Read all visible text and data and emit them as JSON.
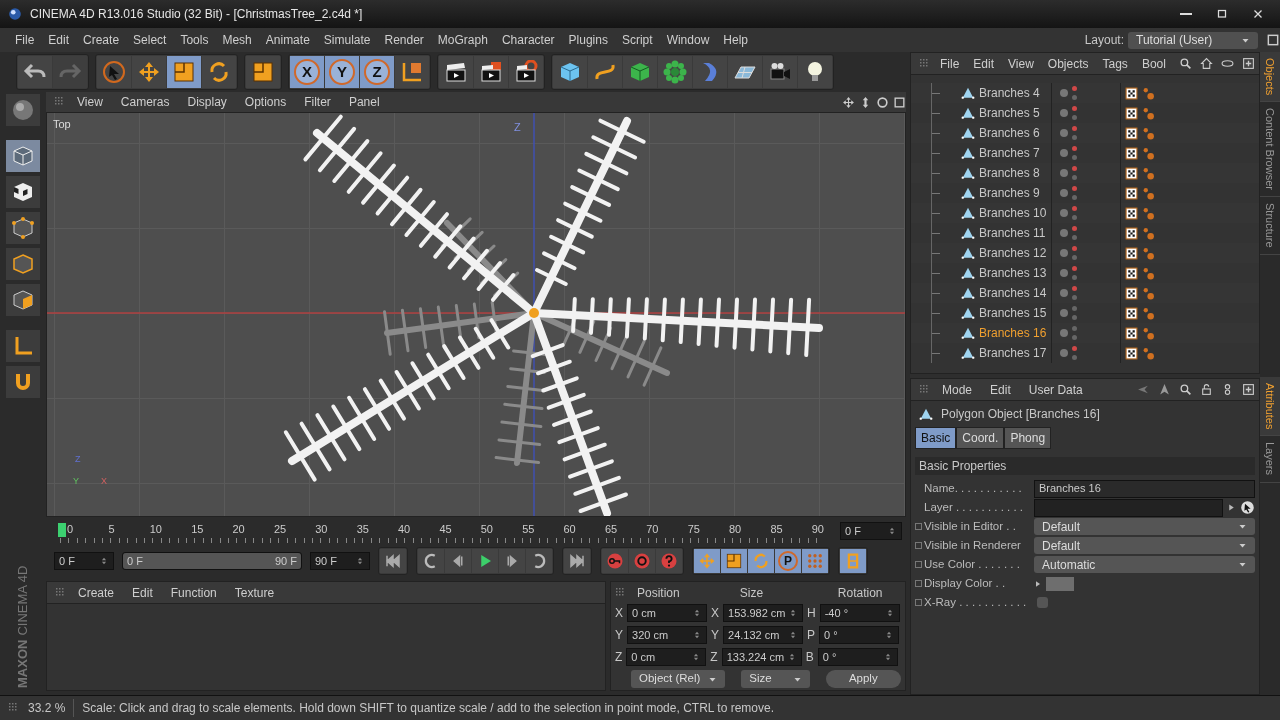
{
  "window": {
    "title": "CINEMA 4D R13.016 Studio (32 Bit) - [ChristmasTree_2.c4d *]"
  },
  "menu": [
    "File",
    "Edit",
    "Create",
    "Select",
    "Tools",
    "Mesh",
    "Animate",
    "Simulate",
    "Render",
    "MoGraph",
    "Character",
    "Plugins",
    "Script",
    "Window",
    "Help"
  ],
  "layout": {
    "label": "Layout:",
    "value": "Tutorial (User)"
  },
  "toolbar": [
    {
      "items": [
        {
          "kind": "undo",
          "disabled": false
        },
        {
          "kind": "redo",
          "disabled": true
        }
      ]
    },
    {
      "items": [
        {
          "kind": "select",
          "selected": false
        },
        {
          "kind": "move",
          "selected": false
        },
        {
          "kind": "scale",
          "selected": true
        },
        {
          "kind": "rotate",
          "selected": false
        }
      ]
    },
    {
      "items": [
        {
          "kind": "scale-model",
          "selected": false
        }
      ]
    },
    {
      "items": [
        {
          "kind": "axis",
          "label": "X",
          "selected": true
        },
        {
          "kind": "axis",
          "label": "Y",
          "selected": true
        },
        {
          "kind": "axis",
          "label": "Z",
          "selected": true
        },
        {
          "kind": "coord",
          "selected": false
        }
      ]
    },
    {
      "items": [
        {
          "kind": "render-view"
        },
        {
          "kind": "render-picture"
        },
        {
          "kind": "render-settings"
        }
      ]
    },
    {
      "items": [
        {
          "kind": "cube"
        },
        {
          "kind": "spline"
        },
        {
          "kind": "nurbs"
        },
        {
          "kind": "array"
        },
        {
          "kind": "deformer"
        },
        {
          "kind": "floor"
        },
        {
          "kind": "camera"
        },
        {
          "kind": "light"
        }
      ]
    }
  ],
  "left_tools": [
    {
      "kind": "nav",
      "selected": false
    },
    {
      "kind": "model",
      "selected": true
    },
    {
      "kind": "texture",
      "selected": false
    },
    {
      "kind": "points",
      "selected": false
    },
    {
      "kind": "edges",
      "selected": false
    },
    {
      "kind": "polygons",
      "selected": false
    },
    {
      "kind": "axis-mode",
      "selected": false
    },
    {
      "kind": "magnet",
      "selected": false
    }
  ],
  "viewport": {
    "menu": [
      "View",
      "Cameras",
      "Display",
      "Options",
      "Filter",
      "Panel"
    ],
    "view_name": "Top",
    "axis_label": "Z",
    "gizmo": {
      "z": "Z",
      "y": "Y",
      "x": "X"
    }
  },
  "timeline": {
    "ticks": [
      "0",
      "5",
      "10",
      "15",
      "20",
      "25",
      "30",
      "35",
      "40",
      "45",
      "50",
      "55",
      "60",
      "65",
      "70",
      "75",
      "80",
      "85",
      "90"
    ],
    "playhead": {
      "level": 0
    },
    "current": "0 F"
  },
  "transport": {
    "start": "0 F",
    "range": {
      "start": "0 F",
      "end": "90 F",
      "level": 1
    },
    "end": "90 F",
    "groups": [
      {
        "items": [
          {
            "kind": "first"
          }
        ]
      },
      {
        "items": [
          {
            "kind": "prev-key"
          },
          {
            "kind": "prev-frame"
          },
          {
            "kind": "play"
          },
          {
            "kind": "next-frame"
          },
          {
            "kind": "next-key"
          }
        ]
      },
      {
        "items": [
          {
            "kind": "last"
          }
        ]
      },
      {
        "items": [
          {
            "kind": "record"
          },
          {
            "kind": "autokey"
          },
          {
            "kind": "keysel"
          }
        ]
      },
      {
        "items": [
          {
            "kind": "key-move",
            "selected": true
          },
          {
            "kind": "key-scale",
            "selected": true
          },
          {
            "kind": "key-rot",
            "selected": true
          },
          {
            "kind": "key-param",
            "label": "P",
            "selected": true
          },
          {
            "kind": "key-pla",
            "selected": true
          }
        ]
      },
      {
        "items": [
          {
            "kind": "timeline",
            "selected": true
          }
        ]
      }
    ]
  },
  "materials": {
    "menu": [
      "Create",
      "Edit",
      "Function",
      "Texture"
    ]
  },
  "coordinates": {
    "headers": [
      "Position",
      "Size",
      "Rotation"
    ],
    "rows": [
      {
        "axis": "X",
        "position": "0 cm",
        "size_axis": "X",
        "size": "153.982 cm",
        "rot_axis": "H",
        "rotation": "-40 °"
      },
      {
        "axis": "Y",
        "position": "320 cm",
        "size_axis": "Y",
        "size": "24.132 cm",
        "rot_axis": "P",
        "rotation": "0 °"
      },
      {
        "axis": "Z",
        "position": "0 cm",
        "size_axis": "Z",
        "size": "133.224 cm",
        "rot_axis": "B",
        "rotation": "0 °"
      }
    ],
    "mode": "Object (Rel)",
    "size_mode": "Size",
    "apply": "Apply"
  },
  "logo": {
    "brand": "MAXON",
    "product": "CINEMA 4D"
  },
  "status_bar": {
    "zoom": "33.2 %",
    "message": "Scale: Click and drag to scale elements. Hold down SHIFT to quantize scale / add to the selection in point mode, CTRL to remove."
  },
  "objects": {
    "menu": [
      "File",
      "Edit",
      "View",
      "Objects",
      "Tags",
      "Bool"
    ],
    "rows": [
      {
        "name": "Branches 4",
        "selected": false,
        "editor_off": true
      },
      {
        "name": "Branches 5",
        "selected": false,
        "editor_off": true
      },
      {
        "name": "Branches 6",
        "selected": false,
        "editor_off": true
      },
      {
        "name": "Branches 7",
        "selected": false,
        "editor_off": true
      },
      {
        "name": "Branches 8",
        "selected": false,
        "editor_off": true
      },
      {
        "name": "Branches 9",
        "selected": false,
        "editor_off": true
      },
      {
        "name": "Branches 10",
        "selected": false,
        "editor_off": true
      },
      {
        "name": "Branches 11",
        "selected": false,
        "editor_off": true
      },
      {
        "name": "Branches 12",
        "selected": false,
        "editor_off": true
      },
      {
        "name": "Branches 13",
        "selected": false,
        "editor_off": true
      },
      {
        "name": "Branches 14",
        "selected": false,
        "editor_off": true
      },
      {
        "name": "Branches 15",
        "selected": false,
        "editor_off": false
      },
      {
        "name": "Branches 16",
        "selected": true,
        "editor_off": false
      },
      {
        "name": "Branches 17",
        "selected": false,
        "editor_off": true
      }
    ],
    "side_tabs": [
      {
        "label": "Objects",
        "selected": true
      },
      {
        "label": "Content Browser",
        "selected": false
      },
      {
        "label": "Structure",
        "selected": false
      }
    ]
  },
  "attributes": {
    "menu": [
      "Mode",
      "Edit",
      "User Data"
    ],
    "object_title": "Polygon Object [Branches 16]",
    "tabs": [
      {
        "label": "Basic",
        "selected": true
      },
      {
        "label": "Coord.",
        "selected": false
      },
      {
        "label": "Phong",
        "selected": false
      }
    ],
    "section": "Basic Properties",
    "fields": [
      {
        "kind": "text",
        "label": "Name. . . . . . . . . . .",
        "value": "Branches 16",
        "keyable": false
      },
      {
        "kind": "link",
        "label": "Layer . . . . . . . . . . .",
        "keyable": false
      },
      {
        "kind": "dropdown",
        "label": "Visible in Editor . .",
        "value": "Default",
        "keyable": true
      },
      {
        "kind": "dropdown",
        "label": "Visible in Renderer",
        "value": "Default",
        "keyable": true
      },
      {
        "kind": "dropdown",
        "label": "Use Color . . . . . . .",
        "value": "Automatic",
        "keyable": true
      },
      {
        "kind": "color",
        "label": "Display Color . .",
        "keyable": true
      },
      {
        "kind": "checkbox",
        "label": "X-Ray . . . . . . . . . . .",
        "checked": false,
        "keyable": true
      }
    ],
    "side_tabs": [
      {
        "label": "Attributes",
        "selected": true
      },
      {
        "label": "Layers",
        "selected": false
      }
    ]
  }
}
